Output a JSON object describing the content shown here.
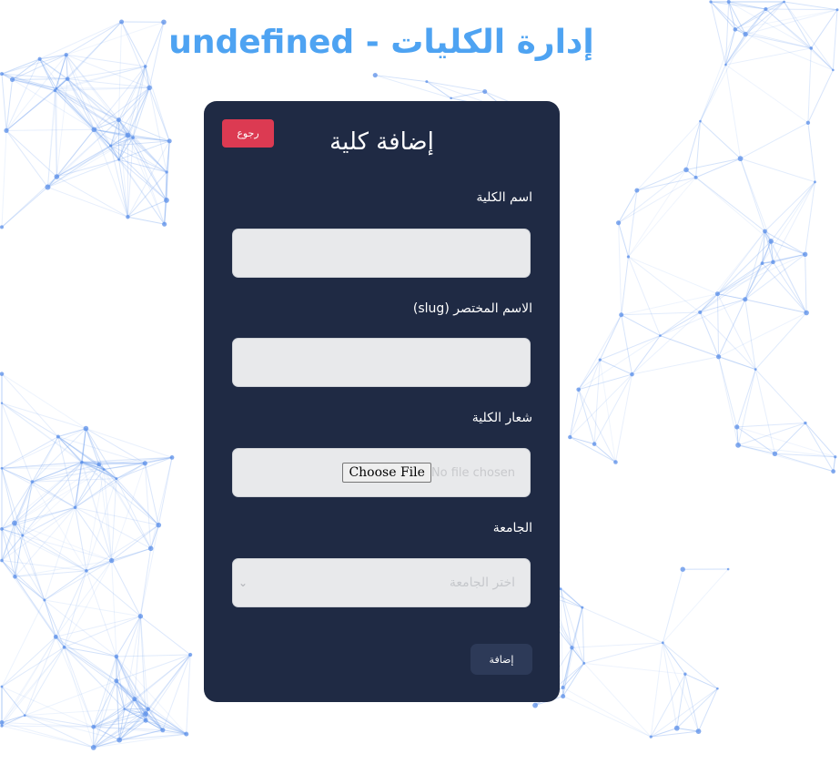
{
  "header": {
    "title": "إدارة الكليات - undefined"
  },
  "card": {
    "back_label": "رجوع",
    "title": "إضافة كلية",
    "fields": {
      "college_name": {
        "label": "اسم الكلية",
        "value": ""
      },
      "slug": {
        "label": "الاسم المختصر (slug)",
        "value": ""
      },
      "logo": {
        "label": "شعار الكلية",
        "button_label": "Choose File",
        "status": "No file chosen"
      },
      "university": {
        "label": "الجامعة",
        "placeholder": "اختر الجامعة"
      }
    },
    "submit_label": "إضافة"
  },
  "colors": {
    "accent": "#4ea3f2",
    "card_bg": "#1f2a44",
    "danger": "#dc3a52",
    "network": "#7aa7f0"
  }
}
